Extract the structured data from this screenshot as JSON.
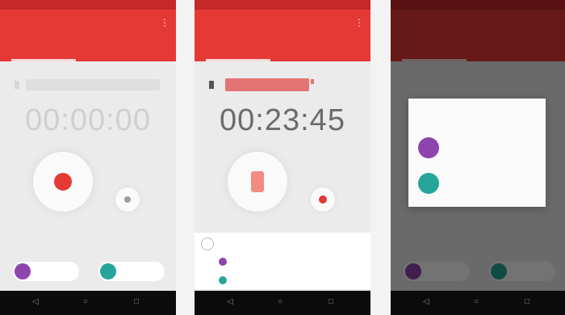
{
  "colors": {
    "primary": "#e53935",
    "primary_dark": "#c62828",
    "purple": "#8e44ad",
    "teal": "#26a69a",
    "background": "#ebebeb",
    "navbar": "#0b0b0b"
  },
  "screens": [
    {
      "app_title": "",
      "tabs": [
        "",
        ""
      ],
      "timer": "00:00:00",
      "contacts": [
        {
          "name": "",
          "sub": ""
        },
        {
          "name": "",
          "sub": ""
        }
      ]
    },
    {
      "app_title": "",
      "tabs": [
        "",
        ""
      ],
      "timer": "00:23:45",
      "list": {
        "header": "",
        "items": [
          "",
          ""
        ]
      }
    },
    {
      "app_title": "",
      "dialog": {
        "title": "",
        "items": [
          {
            "name": "",
            "sub": ""
          },
          {
            "name": "",
            "sub": ""
          }
        ]
      }
    }
  ],
  "icons": {
    "back": "back-icon",
    "home": "home-icon",
    "recents": "recents-icon",
    "menu": "overflow-menu-icon"
  }
}
